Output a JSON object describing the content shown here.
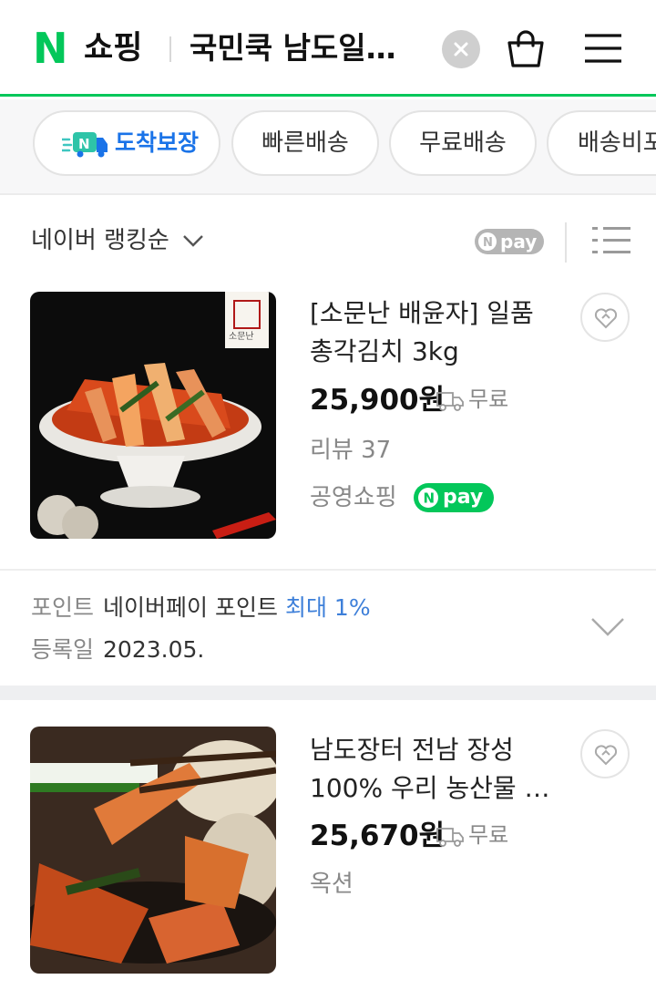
{
  "header": {
    "logo_letter": "N",
    "logo_text": "쇼핑",
    "search_query": "국민쿡 남도일…",
    "brand_color": "#03c75a"
  },
  "filters": {
    "chips": [
      {
        "label": "도착보장",
        "icon": "truck-n-icon"
      },
      {
        "label": "빠른배송"
      },
      {
        "label": "무료배송"
      },
      {
        "label": "배송비포"
      }
    ]
  },
  "sort": {
    "label": "네이버 랭킹순",
    "npay_label": "pay"
  },
  "products": [
    {
      "title": "[소문난 배윤자] 일품 총각김치 3kg",
      "price": "25,900원",
      "shipping": "무료",
      "review": "리뷰 37",
      "mall": "공영쇼핑",
      "npay": "pay",
      "image_badge": "소문난"
    },
    {
      "title": "남도장터 전남 장성 100% 우리 농산물 …",
      "price": "25,670원",
      "shipping": "무료",
      "mall": "옥션"
    }
  ],
  "info": {
    "point_key": "포인트",
    "point_val": "네이버페이 포인트",
    "point_hl": "최대 1%",
    "reg_key": "등록일",
    "reg_val": "2023.05."
  },
  "colors": {
    "accent_blue": "#1a73e8",
    "highlight_blue": "#3d7fd9",
    "npay_green": "#03c75a"
  }
}
